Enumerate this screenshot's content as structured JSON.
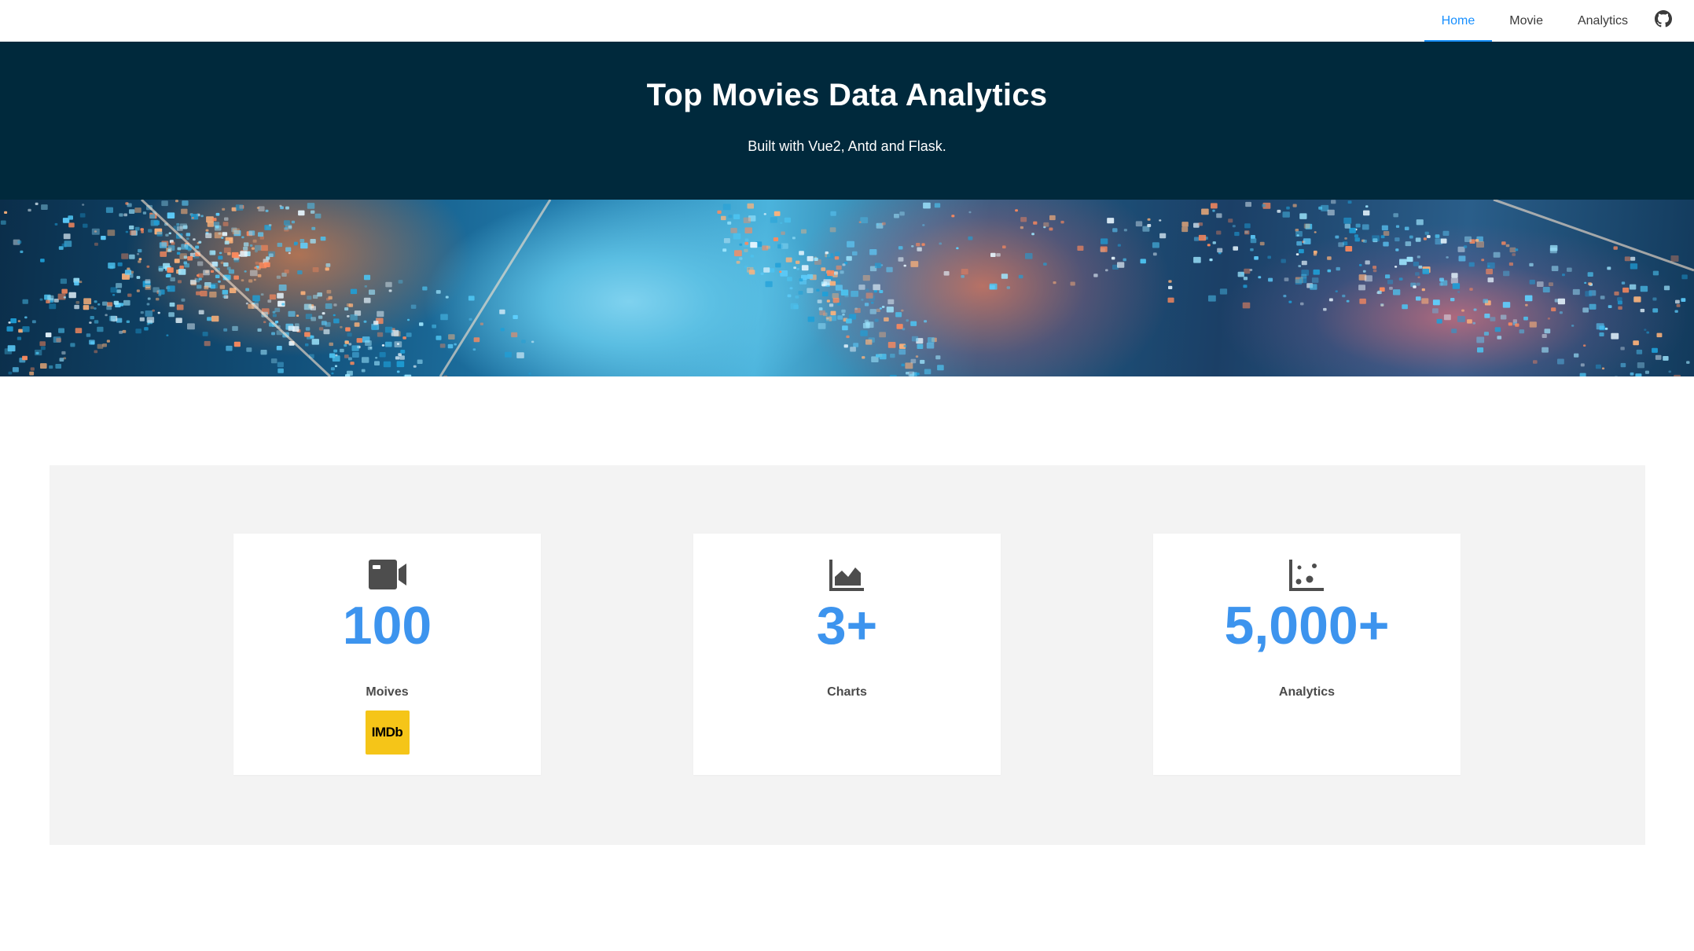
{
  "nav": {
    "items": [
      {
        "label": "Home",
        "active": true
      },
      {
        "label": "Movie",
        "active": false
      },
      {
        "label": "Analytics",
        "active": false
      }
    ],
    "github_icon": "github-icon",
    "accent_color": "#1890ff"
  },
  "hero": {
    "title": "Top Movies Data Analytics",
    "subtitle": "Built with Vue2, Antd and Flask.",
    "background_color": "#00293c"
  },
  "banner": {
    "image": "abstract-data-streams-banner"
  },
  "stats": [
    {
      "icon": "video-camera-icon",
      "value": "100",
      "label": "Moives",
      "logo_text": "IMDb"
    },
    {
      "icon": "area-chart-icon",
      "value": "3+",
      "label": "Charts"
    },
    {
      "icon": "dot-chart-icon",
      "value": "5,000+",
      "label": "Analytics"
    }
  ],
  "colors": {
    "stat_value": "#3d94ee",
    "stats_background": "#f3f3f3",
    "imdb_yellow": "#f5c518"
  }
}
